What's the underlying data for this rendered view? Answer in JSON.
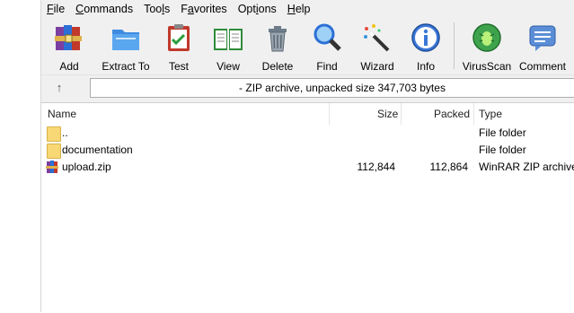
{
  "menu": {
    "file": {
      "u": "F",
      "rest": "ile"
    },
    "commands": {
      "u": "C",
      "rest": "ommands"
    },
    "tools": {
      "pre": "Too",
      "u": "l",
      "rest": "s"
    },
    "favorites": {
      "pre": "F",
      "u": "a",
      "rest": "vorites"
    },
    "options": {
      "pre": "Opt",
      "u": "i",
      "rest": "ons"
    },
    "help": {
      "u": "H",
      "rest": "elp"
    }
  },
  "toolbar": {
    "add": "Add",
    "extract": "Extract To",
    "test": "Test",
    "view": "View",
    "delete": "Delete",
    "find": "Find",
    "wizard": "Wizard",
    "info": "Info",
    "virusscan": "VirusScan",
    "comment": "Comment"
  },
  "address": {
    "up_icon": "up-arrow-icon",
    "path": "- ZIP archive, unpacked size 347,703 bytes"
  },
  "columns": {
    "name": "Name",
    "size": "Size",
    "packed": "Packed",
    "type": "Type"
  },
  "files": [
    {
      "name": "..",
      "size": "",
      "packed": "",
      "type": "File folder",
      "icon": "folder-icon"
    },
    {
      "name": "documentation",
      "size": "",
      "packed": "",
      "type": "File folder",
      "icon": "folder-icon"
    },
    {
      "name": "upload.zip",
      "size": "112,844",
      "packed": "112,864",
      "type": "WinRAR ZIP archive",
      "icon": "zip-archive-icon"
    }
  ],
  "colors": {
    "window_bg": "#f0f0f0",
    "list_bg": "#ffffff",
    "folder": "#f8d775"
  }
}
